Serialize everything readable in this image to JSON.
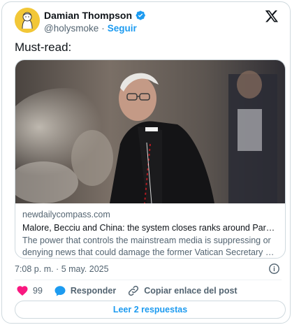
{
  "author": {
    "display_name": "Damian Thompson",
    "handle": "@holysmoke",
    "separator": "·",
    "follow_label": "Seguir",
    "verified": true
  },
  "tweet": {
    "text": "Must-read:"
  },
  "link_card": {
    "domain": "newdailycompass.com",
    "title": "Malore, Becciu and China: the system closes ranks around Parolin",
    "description": "The power that controls the mainstream media is suppressing or denying news that could damage the former Vatican Secretary of State in the rac..."
  },
  "meta": {
    "timestamp": "7:08 p. m. · 5 may. 2025"
  },
  "actions": {
    "like_count": "99",
    "reply_label": "Responder",
    "copy_link_label": "Copiar enlace del post"
  },
  "footer": {
    "read_replies_label": "Leer 2 respuestas"
  },
  "colors": {
    "accent": "#1d9bf0",
    "like": "#f91880",
    "text_primary": "#0f1419",
    "text_secondary": "#536471",
    "border": "#cfd9de"
  },
  "icons": [
    "verified-badge-icon",
    "x-logo-icon",
    "info-icon",
    "heart-icon",
    "reply-bubble-icon",
    "link-icon"
  ]
}
